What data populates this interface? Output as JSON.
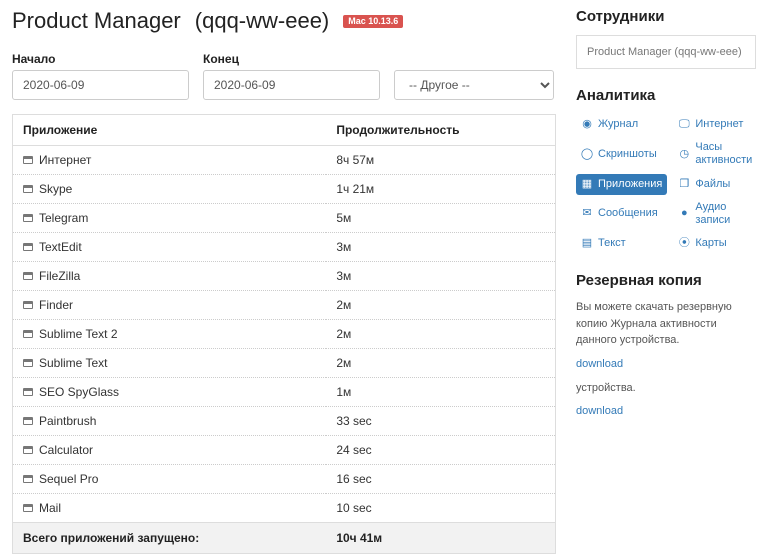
{
  "header": {
    "title": "Product Manager",
    "subtitle": "(qqq-ww-eee)",
    "badge": "Mac 10.13.6"
  },
  "filters": {
    "start_label": "Начало",
    "start_value": "2020-06-09",
    "end_label": "Конец",
    "end_value": "2020-06-09",
    "other_label": "-- Другое --"
  },
  "table": {
    "col_app": "Приложение",
    "col_dur": "Продолжительность",
    "rows": [
      {
        "app": "Интернет",
        "dur": "8ч 57м"
      },
      {
        "app": "Skype",
        "dur": "1ч 21м"
      },
      {
        "app": "Telegram",
        "dur": "5м"
      },
      {
        "app": "TextEdit",
        "dur": "3м"
      },
      {
        "app": "FileZilla",
        "dur": "3м"
      },
      {
        "app": "Finder",
        "dur": "2м"
      },
      {
        "app": "Sublime Text 2",
        "dur": "2м"
      },
      {
        "app": "Sublime Text",
        "dur": "2м"
      },
      {
        "app": "SEO SpyGlass",
        "dur": "1м"
      },
      {
        "app": "Paintbrush",
        "dur": "33 sec"
      },
      {
        "app": "Calculator",
        "dur": "24 sec"
      },
      {
        "app": "Sequel Pro",
        "dur": "16 sec"
      },
      {
        "app": "Mail",
        "dur": "10 sec"
      }
    ],
    "total_label": "Всего приложений запущено:",
    "total_value": "10ч 41м"
  },
  "side": {
    "employees_heading": "Сотрудники",
    "employee_value": "Product Manager (qqq-ww-eee)",
    "analytics_heading": "Аналитика",
    "nav": [
      {
        "icon": "eye-icon",
        "glyph": "◉",
        "label": "Журнал",
        "active": false
      },
      {
        "icon": "monitor-icon",
        "glyph": "🖵",
        "label": "Интернет",
        "active": false
      },
      {
        "icon": "camera-icon",
        "glyph": "◯",
        "label": "Скриншоты",
        "active": false
      },
      {
        "icon": "clock-icon",
        "glyph": "◷",
        "label": "Часы активности",
        "active": false
      },
      {
        "icon": "grid-icon",
        "glyph": "▦",
        "label": "Приложения",
        "active": true
      },
      {
        "icon": "file-icon",
        "glyph": "❐",
        "label": "Файлы",
        "active": false
      },
      {
        "icon": "chat-icon",
        "glyph": "✉",
        "label": "Сообщения",
        "active": false
      },
      {
        "icon": "mic-icon",
        "glyph": "●",
        "label": "Аудио записи",
        "active": false
      },
      {
        "icon": "text-icon",
        "glyph": "▤",
        "label": "Текст",
        "active": false
      },
      {
        "icon": "globe-icon",
        "glyph": "⦿",
        "label": "Карты",
        "active": false
      }
    ],
    "backup_heading": "Резервная копия",
    "backup_text1": "Вы можете скачать резервную копию Журнала активности данного устройства.",
    "backup_link1": "download",
    "backup_text2": "устройства.",
    "backup_link2": "download"
  }
}
